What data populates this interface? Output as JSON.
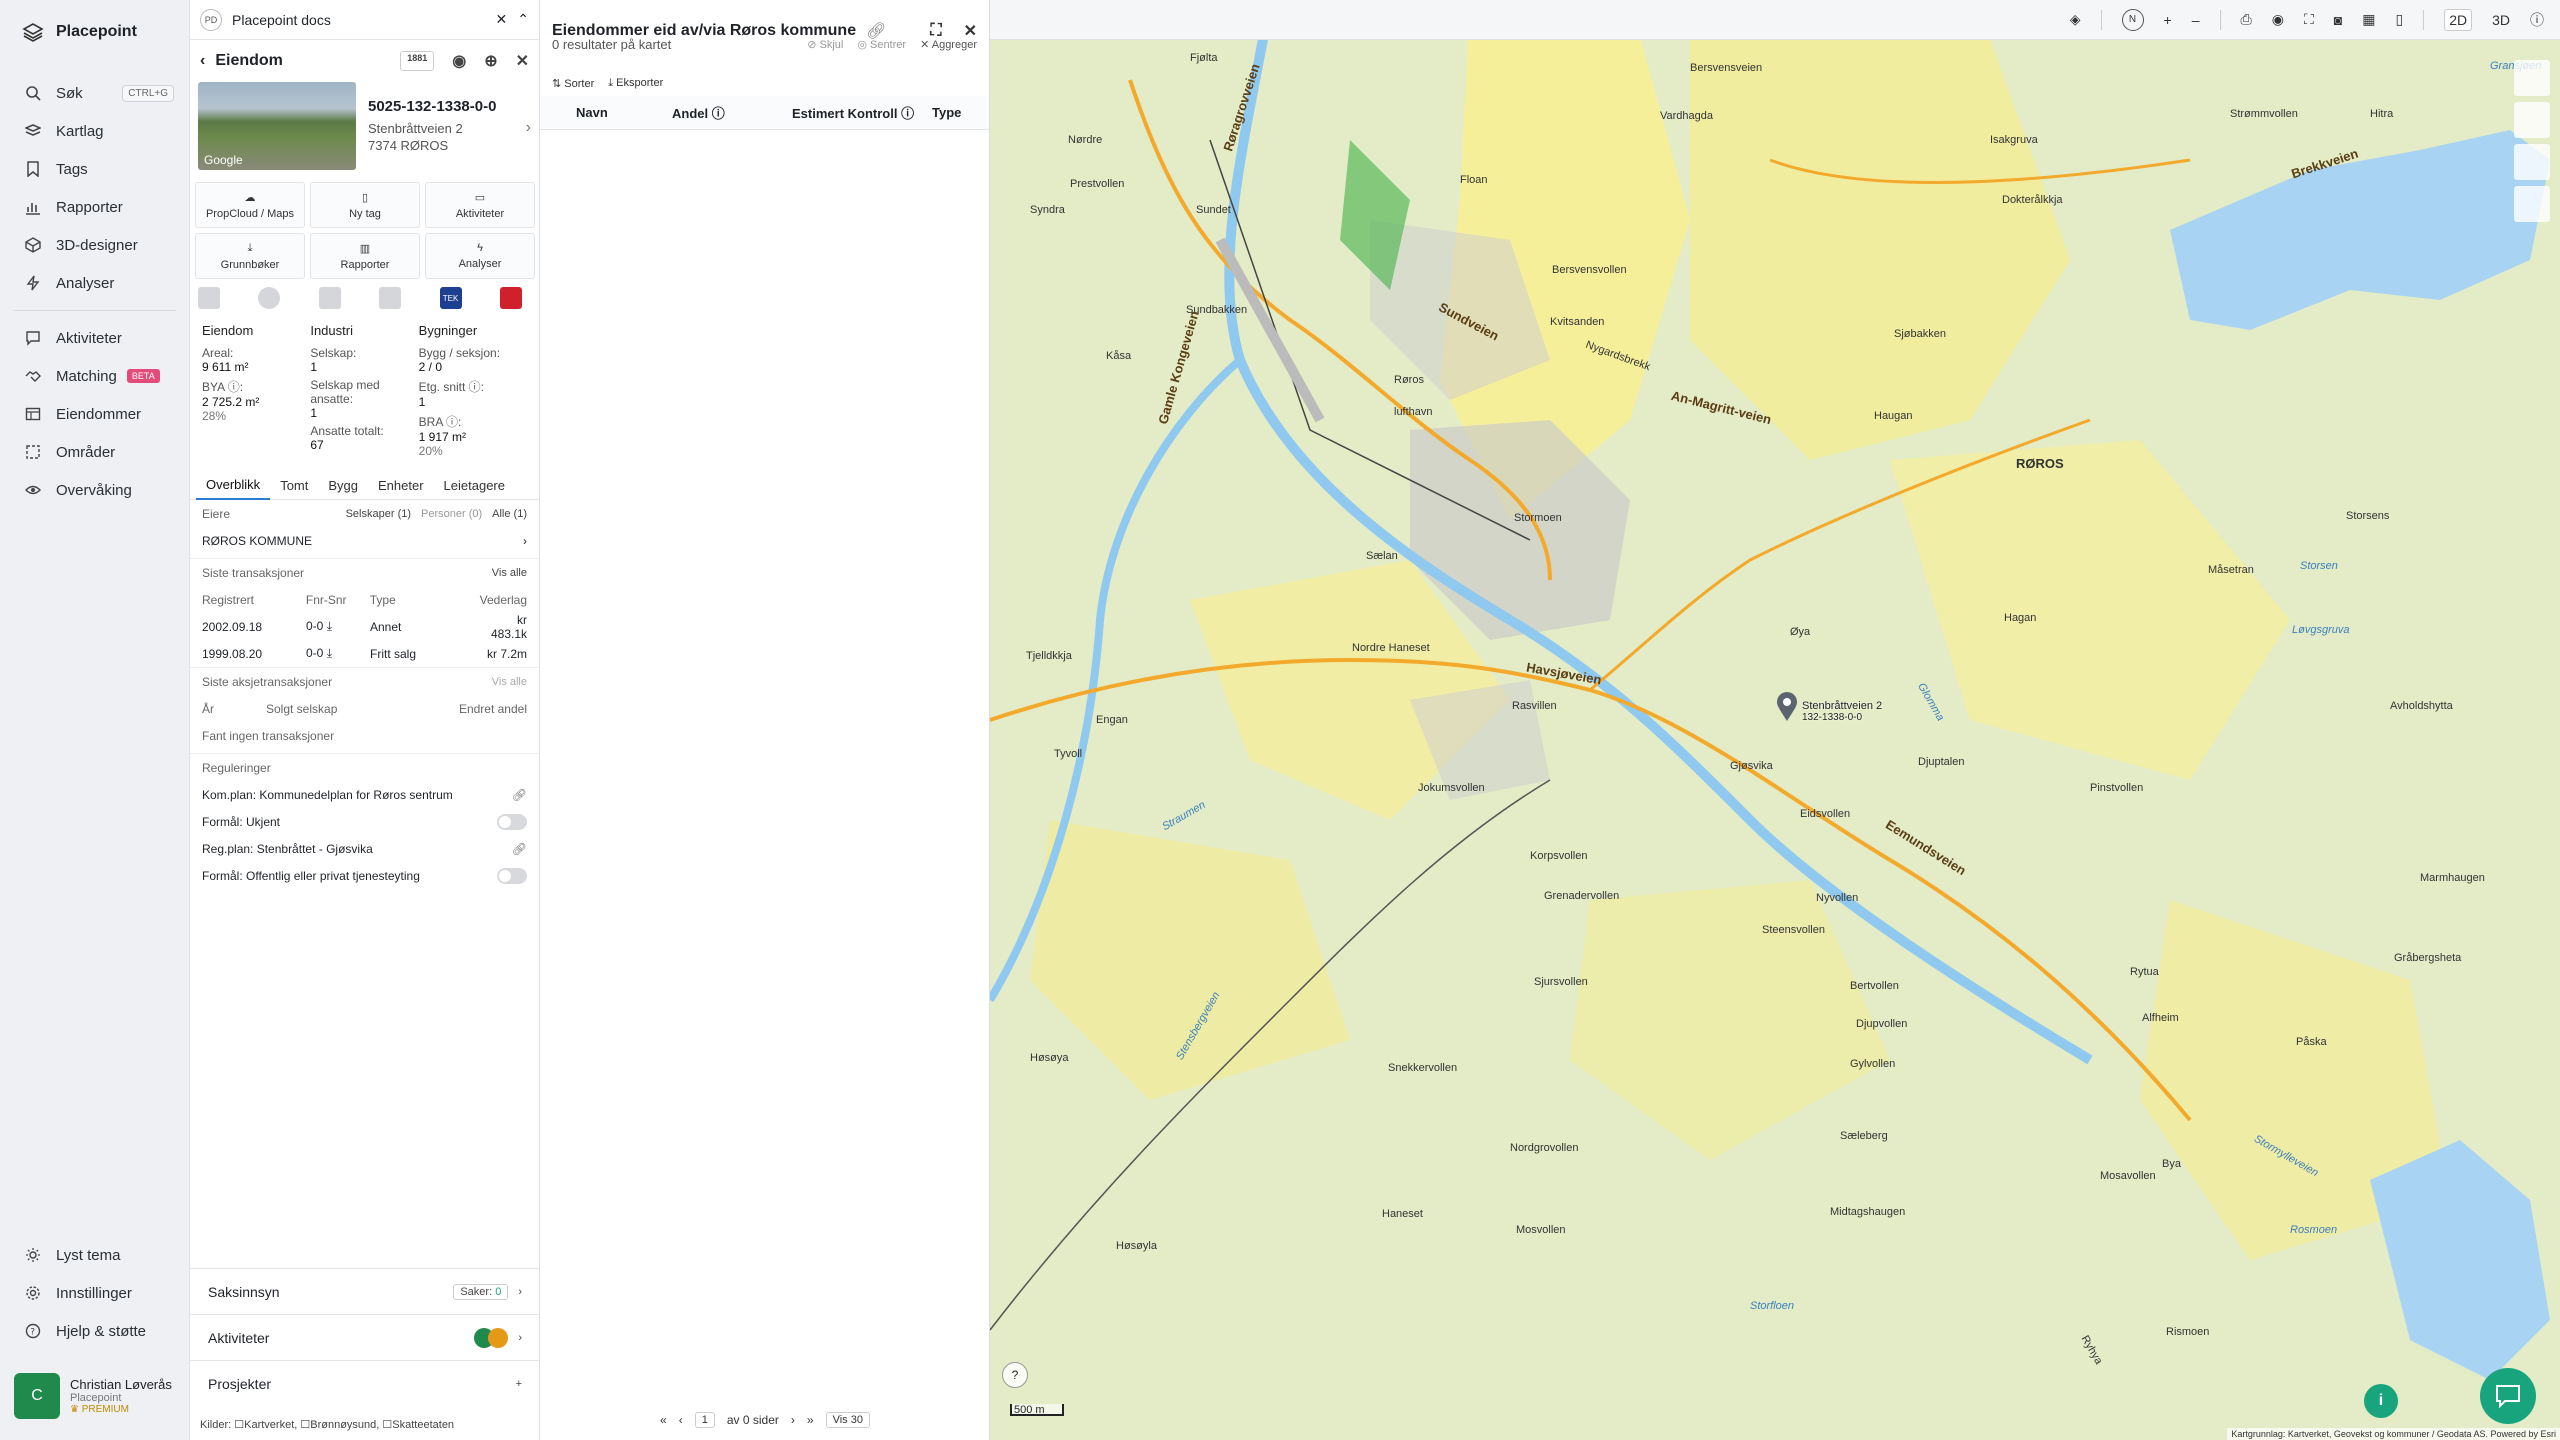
{
  "app": {
    "name": "Placepoint"
  },
  "sidebar": {
    "items": [
      {
        "label": "Søk",
        "icon": "search-icon",
        "shortcut": "CTRL+G"
      },
      {
        "label": "Kartlag",
        "icon": "layers-icon"
      },
      {
        "label": "Tags",
        "icon": "bookmark-icon"
      },
      {
        "label": "Rapporter",
        "icon": "bar-chart-icon"
      },
      {
        "label": "3D-designer",
        "icon": "cube-icon"
      },
      {
        "label": "Analyser",
        "icon": "lightning-icon"
      },
      {
        "label": "Aktiviteter",
        "icon": "chat-icon"
      },
      {
        "label": "Matching",
        "icon": "handshake-icon",
        "badge": "BETA"
      },
      {
        "label": "Eiendommer",
        "icon": "table-icon"
      },
      {
        "label": "Områder",
        "icon": "area-icon"
      },
      {
        "label": "Overvåking",
        "icon": "eye-icon"
      }
    ],
    "bottom": [
      {
        "label": "Lyst tema",
        "icon": "sun-icon"
      },
      {
        "label": "Innstillinger",
        "icon": "gear-icon"
      },
      {
        "label": "Hjelp & støtte",
        "icon": "help-icon"
      }
    ],
    "user": {
      "initial": "C",
      "name": "Christian Løverås",
      "org": "Placepoint",
      "plan": "PREMIUM"
    }
  },
  "docbar": {
    "badge": "PD",
    "title": "Placepoint docs"
  },
  "detail": {
    "title": "Eiendom",
    "tool_badge": "1881",
    "thumb_label": "Google",
    "property": {
      "id": "5025-132-1338-0-0",
      "street": "Stenbråttveien 2",
      "postal": "7374 RØROS"
    },
    "actions": [
      "PropCloud / Maps",
      "Ny tag",
      "Aktiviteter",
      "Grunnbøker",
      "Rapporter",
      "Analyser"
    ],
    "tek_label": "TEK",
    "stats": {
      "col1": {
        "header": "Eiendom",
        "areal_label": "Areal:",
        "areal_value": "9 611 m²",
        "bya_label": "BYA ⓘ:",
        "bya_value": "2 725.2 m²",
        "bya_pct": "28%"
      },
      "col2": {
        "header": "Industri",
        "selskap_label": "Selskap:",
        "selskap_value": "1",
        "ansatte_label": "Selskap med ansatte:",
        "ansatte_value": "1",
        "ansatte_tot_label": "Ansatte totalt:",
        "ansatte_tot_value": "67"
      },
      "col3": {
        "header": "Bygninger",
        "bygg_label": "Bygg / seksjon:",
        "bygg_value": "2 / 0",
        "etg_label": "Etg. snitt ⓘ:",
        "etg_value": "1",
        "bra_label": "BRA ⓘ:",
        "bra_value": "1 917 m²",
        "bra_pct": "20%"
      }
    },
    "tabs": [
      "Overblikk",
      "Tomt",
      "Bygg",
      "Enheter",
      "Leietagere"
    ],
    "owners": {
      "label": "Eiere",
      "filters": [
        "Selskaper (1)",
        "Personer (0)",
        "Alle (1)"
      ],
      "owner": "RØROS KOMMUNE"
    },
    "transactions": {
      "label": "Siste transaksjoner",
      "view_all": "Vis alle",
      "columns": [
        "Registrert",
        "Fnr-Snr",
        "Type",
        "Vederlag"
      ],
      "rows": [
        {
          "date": "2002.09.18",
          "fnr": "0-0",
          "type": "Annet",
          "price": "kr 483.1k"
        },
        {
          "date": "1999.08.20",
          "fnr": "0-0",
          "type": "Fritt salg",
          "price": "kr 7.2m"
        }
      ]
    },
    "share_tx": {
      "label": "Siste aksjetransaksjoner",
      "view_all": "Vis alle",
      "columns": [
        "År",
        "Solgt selskap",
        "Endret andel"
      ],
      "empty": "Fant ingen transaksjoner"
    },
    "regulations": {
      "label": "Reguleringer",
      "items": [
        {
          "text": "Kom.plan: Kommunedelplan for Røros sentrum",
          "kind": "link"
        },
        {
          "text": "Formål: Ukjent",
          "kind": "toggle"
        },
        {
          "text": "Reg.plan: Stenbråttet - Gjøsvika",
          "kind": "link"
        },
        {
          "text": "Formål: Offentlig eller privat tjenesteyting",
          "kind": "toggle"
        }
      ]
    },
    "accordions": {
      "saksinnsyn": "Saksinnsyn",
      "saker_label": "Saker:",
      "saker_count": "0",
      "aktiviteter": "Aktiviteter",
      "prosjekter": "Prosjekter"
    },
    "sources": {
      "label": "Kilder:",
      "items": [
        "Kartverket,",
        "Brønnøysund,",
        "Skatteetaten"
      ]
    }
  },
  "list": {
    "title": "Eiendommer eid av/via Røros kommune",
    "results": "0 resultater på kartet",
    "map_actions": [
      "Skjul",
      "Sentrer",
      "Aggreger"
    ],
    "tools": [
      "Sorter",
      "Eksporter"
    ],
    "columns": [
      "Navn",
      "Andel ⓘ",
      "Estimert Kontroll ⓘ",
      "Type"
    ],
    "pager": {
      "page": "1",
      "of": "av 0 sider",
      "per_page": "Vis 30"
    }
  },
  "map": {
    "toolbar": {
      "mode2d": "2D",
      "mode3d": "3D",
      "plus": "+",
      "minus": "–",
      "north": "N"
    },
    "labels": [
      {
        "t": "Fjølta"
      },
      {
        "t": "Røragrovveien"
      },
      {
        "t": "Bersvensveien"
      },
      {
        "t": "Gransjøen"
      },
      {
        "t": "Nørdre"
      },
      {
        "t": "Vardhagda"
      },
      {
        "t": "Isakgruva"
      },
      {
        "t": "Strømmvollen"
      },
      {
        "t": "Prestvollen"
      },
      {
        "t": "Floan"
      },
      {
        "t": "Dokterålkkja"
      },
      {
        "t": "Brekkveien"
      },
      {
        "t": "Syndra"
      },
      {
        "t": "Sundet"
      },
      {
        "t": "Bersvensvollen"
      },
      {
        "t": "Sjøbakken"
      },
      {
        "t": "Sundbakken"
      },
      {
        "t": "Sundveien"
      },
      {
        "t": "Kvitsanden"
      },
      {
        "t": "Nygardsbrekk"
      },
      {
        "t": "Kåsa"
      },
      {
        "t": "Gamle Kongeveien"
      },
      {
        "t": "Røros"
      },
      {
        "t": "lufthavn"
      },
      {
        "t": "An-Magritt-veien"
      },
      {
        "t": "Haugan"
      },
      {
        "t": "RØROS"
      },
      {
        "t": "Storsens"
      },
      {
        "t": "Stormoen"
      },
      {
        "t": "Sælan"
      },
      {
        "t": "Måsetran"
      },
      {
        "t": "Storsen"
      },
      {
        "t": "Øya"
      },
      {
        "t": "Hagan"
      },
      {
        "t": "Løvgsgruva"
      },
      {
        "t": "Tjelldkkja"
      },
      {
        "t": "Havsjøveien"
      },
      {
        "t": "Nordre Haneset"
      },
      {
        "t": "Rasvillen"
      },
      {
        "t": "Avholdshytta"
      },
      {
        "t": "Engan"
      },
      {
        "t": "Gjøsvika"
      },
      {
        "t": "Djuptalen"
      },
      {
        "t": "Tyvoll"
      },
      {
        "t": "Pinstvollen"
      },
      {
        "t": "Jokumsvollen"
      },
      {
        "t": "Eidsvollen"
      },
      {
        "t": "Straumen"
      },
      {
        "t": "Korpsvollen"
      },
      {
        "t": "Grenadervollen"
      },
      {
        "t": "Steensvollen"
      },
      {
        "t": "Nyvollen"
      },
      {
        "t": "Marmhaugen"
      },
      {
        "t": "Gråbergsheta"
      },
      {
        "t": "Sjursvollen"
      },
      {
        "t": "Bertvollen"
      },
      {
        "t": "Rytua"
      },
      {
        "t": "Djupvollen"
      },
      {
        "t": "Alfheim"
      },
      {
        "t": "Påska"
      },
      {
        "t": "Høsøya"
      },
      {
        "t": "Snekkervollen"
      },
      {
        "t": "Gylvollen"
      },
      {
        "t": "Nordgrovollen"
      },
      {
        "t": "Sæleberg"
      },
      {
        "t": "Bya"
      },
      {
        "t": "Haneset"
      },
      {
        "t": "Mosvollen"
      },
      {
        "t": "Midtagshaugen"
      },
      {
        "t": "Rosmoen"
      },
      {
        "t": "Høsøyla"
      },
      {
        "t": "Storfloen"
      },
      {
        "t": "Rismoen"
      },
      {
        "t": "Mosavollen"
      },
      {
        "t": "Stensbergveien"
      },
      {
        "t": "Stormylleveien"
      },
      {
        "t": "Eemundsveien"
      },
      {
        "t": "Glomma"
      },
      {
        "t": "Ryhya"
      },
      {
        "t": "Hitra"
      }
    ],
    "pin_label": "Stenbråttveien 2",
    "pin_sub": "132-1338-0-0",
    "scale": "500 m",
    "attribution": "Kartgrunnlag: Kartverket, Geovekst og kommuner / Geodata AS. Powered by Esri"
  }
}
